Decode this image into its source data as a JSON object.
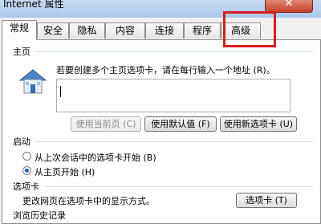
{
  "window": {
    "title": "Internet 属性",
    "close_symbol": "✕"
  },
  "tabs": [
    {
      "label": "常规",
      "active": true
    },
    {
      "label": "安全"
    },
    {
      "label": "隐私"
    },
    {
      "label": "内容"
    },
    {
      "label": "连接"
    },
    {
      "label": "程序"
    },
    {
      "label": "高级"
    }
  ],
  "homepage": {
    "section_label": "主页",
    "instruction": "若要创建多个主页选项卡，请在每行输入一个地址 (R)。",
    "value": "",
    "buttons": {
      "use_current": "使用当前页 (C)",
      "use_default": "使用默认值 (F)",
      "use_new_tab": "使用新选项卡 (U)"
    }
  },
  "startup": {
    "section_label": "启动",
    "options": [
      {
        "label": "从上次会话中的选项卡开始 (B)",
        "checked": false
      },
      {
        "label": "从主页开始 (H)",
        "checked": true
      }
    ]
  },
  "tabs_section": {
    "section_label": "选项卡",
    "description": "更改网页在选项卡中的显示方式。",
    "button": "选项卡 (T)"
  },
  "history": {
    "section_label": "浏览历史记录"
  },
  "highlight_color": "#d71e1e"
}
